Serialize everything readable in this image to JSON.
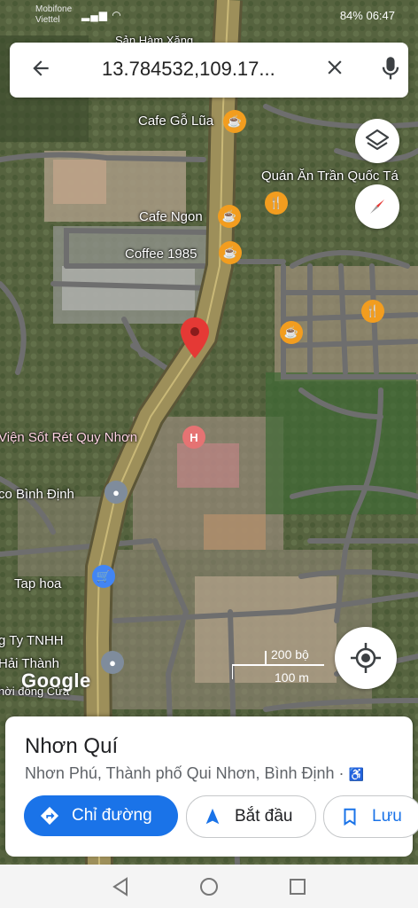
{
  "status": {
    "carrier_line1": "Mobifone",
    "carrier_line2": "Viettel",
    "right_text": "84% 06:47"
  },
  "search": {
    "query": "13.784532,109.17..."
  },
  "map_labels": {
    "cafe_go_lua": "Cafe Gỗ Lũa",
    "quan_an": "Quán Ăn Trần Quốc Tá",
    "cafe_ngon": "Cafe Ngon",
    "coffee_1985": "Coffee 1985",
    "vien_sot_ret": "Viện Sốt Rét Quy Nhơn",
    "binh_dinh": "co Bình Định",
    "tap_hoa": "Tap hoa",
    "cong_ty_line1": "g Ty TNHH",
    "cong_ty_line2": "Hải Thành",
    "cong_ty_line3": "hời đồng Cửa",
    "top_partial": "Sản Hàm Xăng"
  },
  "scale": {
    "imperial": "200 bộ",
    "metric": "100 m"
  },
  "google_logo": "Google",
  "place": {
    "title": "Nhơn Quí",
    "subtitle": "Nhơn Phú, Thành phố Qui Nhơn, Bình Định ·"
  },
  "actions": {
    "directions": "Chỉ đường",
    "start": "Bắt đầu",
    "save": "Lưu"
  },
  "colors": {
    "accent": "#1a73e8",
    "pin": "#e53935",
    "cafe": "#f29d1f",
    "hospital": "#e57373"
  }
}
